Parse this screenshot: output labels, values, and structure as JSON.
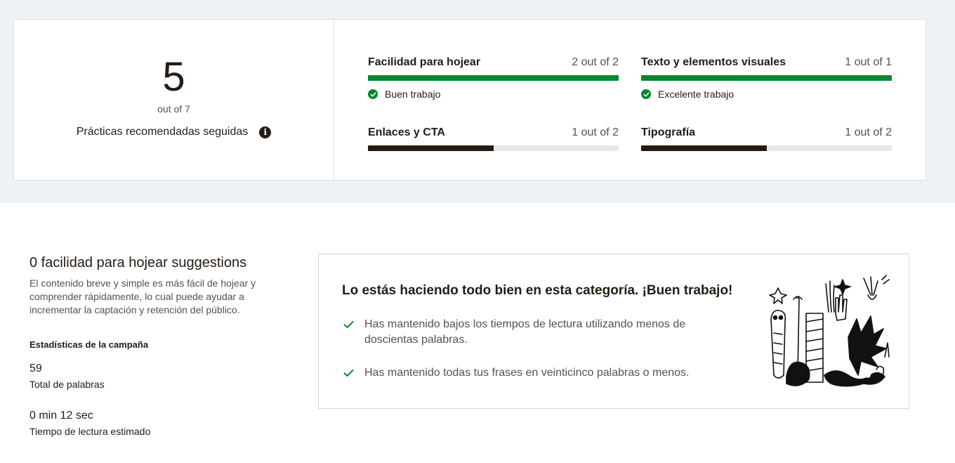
{
  "summary": {
    "score": "5",
    "score_outof": "out of 7",
    "label": "Prácticas recomendadas seguidas",
    "info_icon": "info-icon"
  },
  "metrics": [
    {
      "title": "Facilidad para hojear",
      "count": "2 out of 2",
      "fraction": 1.0,
      "color": "#00892e",
      "status": "Buen trabajo"
    },
    {
      "title": "Texto y elementos visuales",
      "count": "1 out of 1",
      "fraction": 1.0,
      "color": "#00892e",
      "status": "Excelente trabajo"
    },
    {
      "title": "Enlaces y CTA",
      "count": "1 out of 2",
      "fraction": 0.5,
      "color": "#241c15",
      "status": ""
    },
    {
      "title": "Tipografía",
      "count": "1 out of 2",
      "fraction": 0.5,
      "color": "#241c15",
      "status": ""
    }
  ],
  "details": {
    "title": "0 facilidad para hojear suggestions",
    "description": "El contenido breve y simple es más fácil de hojear y comprender rápidamente, lo cual puede ayudar a incrementar la captación y retención del público.",
    "stats_heading": "Estadísticas de la campaña",
    "stats": [
      {
        "value": "59",
        "label": "Total de palabras"
      },
      {
        "value": "0 min 12 sec",
        "label": "Tiempo de lectura estimado"
      }
    ]
  },
  "feedback": {
    "title": "Lo estás haciendo todo bien en esta categoría. ¡Buen trabajo!",
    "items": [
      "Has mantenido bajos los tiempos de lectura utilizando menos de doscientas palabras.",
      "Has mantenido todas tus frases en veinticinco palabras o menos."
    ],
    "illustration": "doodle-illustration"
  },
  "colors": {
    "success": "#00892e",
    "neutral_bar": "#241c15",
    "track": "#e6e9ec",
    "band": "#eff2f5"
  }
}
